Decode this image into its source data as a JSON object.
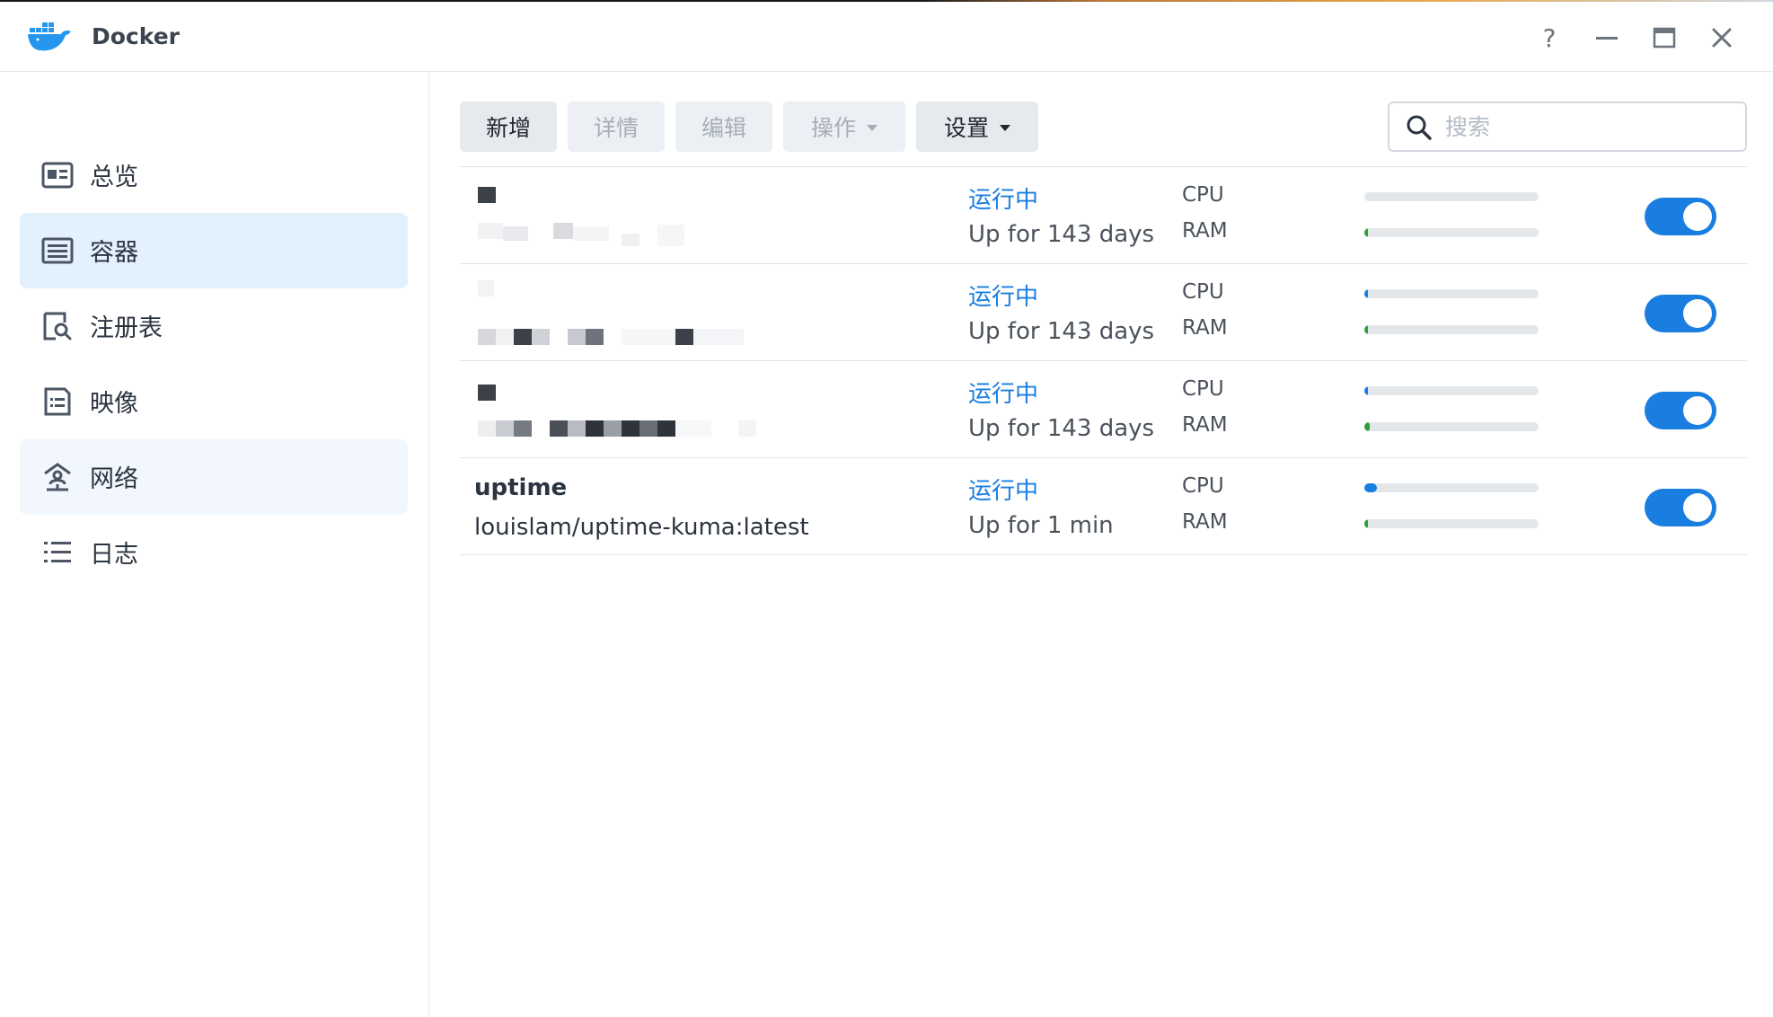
{
  "window": {
    "title": "Docker",
    "help_label": "?"
  },
  "sidebar": {
    "items": [
      {
        "label": "总览",
        "icon": "overview-icon"
      },
      {
        "label": "容器",
        "icon": "container-list-icon"
      },
      {
        "label": "注册表",
        "icon": "registry-search-icon"
      },
      {
        "label": "映像",
        "icon": "image-doc-icon"
      },
      {
        "label": "网络",
        "icon": "network-icon"
      },
      {
        "label": "日志",
        "icon": "log-list-icon"
      }
    ]
  },
  "toolbar": {
    "new_label": "新增",
    "details_label": "详情",
    "edit_label": "编辑",
    "action_label": "操作",
    "settings_label": "设置"
  },
  "search": {
    "placeholder": "搜索"
  },
  "containers": [
    {
      "name": "",
      "image": "",
      "status": "运行中",
      "uptime": "Up for 143 days",
      "cpu_label": "CPU",
      "ram_label": "RAM",
      "cpu_pct": 0,
      "ram_pct": 1,
      "enabled": true
    },
    {
      "name": "",
      "image": "",
      "status": "运行中",
      "uptime": "Up for 143 days",
      "cpu_label": "CPU",
      "ram_label": "RAM",
      "cpu_pct": 1,
      "ram_pct": 1,
      "enabled": true
    },
    {
      "name": "",
      "image": "",
      "status": "运行中",
      "uptime": "Up for 143 days",
      "cpu_label": "CPU",
      "ram_label": "RAM",
      "cpu_pct": 1,
      "ram_pct": 3,
      "enabled": true
    },
    {
      "name": "uptime",
      "image": "louislam/uptime-kuma:latest",
      "status": "运行中",
      "uptime": "Up for 1 min",
      "cpu_label": "CPU",
      "ram_label": "RAM",
      "cpu_pct": 7,
      "ram_pct": 2,
      "enabled": true
    }
  ],
  "colors": {
    "accent": "#1a7de0",
    "cpu_bar": "#1a7de0",
    "ram_bar": "#2e9e3a",
    "active_nav": "#e3f1fc"
  }
}
